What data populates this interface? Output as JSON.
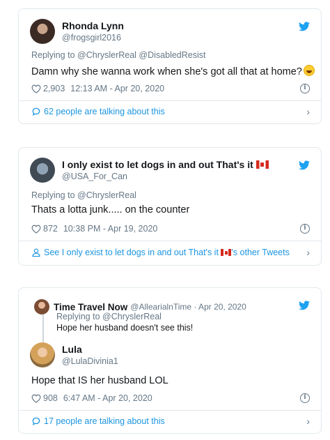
{
  "colors": {
    "twitter_blue": "#1b95e0",
    "secondary": "#657786",
    "border": "#e1e8ed"
  },
  "tweet1": {
    "name": "Rhonda Lynn",
    "handle": "@frogsgirl2016",
    "replying_prefix": "Replying to",
    "replying_to": "@ChryslerReal @DisabledResist",
    "text": "Damn why she wanna work when she's got all that at home?",
    "emoji_icon": "rolling-on-floor-laughing-emoji",
    "likes": "2,903",
    "timestamp": "12:13 AM - Apr 20, 2020",
    "footer": "62 people are talking about this"
  },
  "tweet2": {
    "name": "I only exist to let dogs in and out That's it",
    "handle": "@USA_For_Can",
    "replying_prefix": "Replying to",
    "replying_to": "@ChryslerReal",
    "text": "Thats a lotta junk..... on the counter",
    "likes": "872",
    "timestamp": "10:38 PM - Apr 19, 2020",
    "footer_prefix": "See I only exist to let dogs in and out That's it",
    "footer_suffix": "'s other Tweets"
  },
  "tweet3": {
    "quoted": {
      "name": "Time Travel Now",
      "handle_date": "@AllearialnTime · Apr 20, 2020",
      "replying_prefix": "Replying to",
      "replying_to": "@ChryslerReal",
      "text": "Hope her husband doesn't see this!"
    },
    "name": "Lula",
    "handle": "@LulaDivinia1",
    "text": "Hope that IS her husband LOL",
    "likes": "908",
    "timestamp": "6:47 AM - Apr 20, 2020",
    "footer": "17 people are talking about this"
  }
}
